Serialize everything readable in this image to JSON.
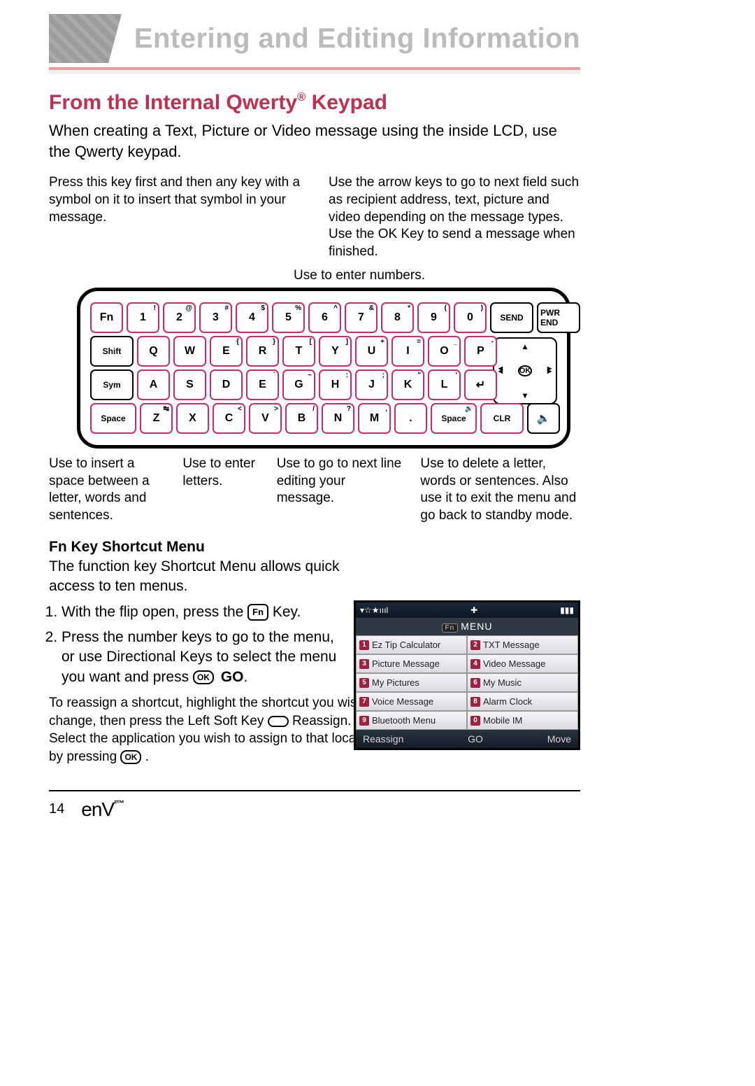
{
  "header": {
    "chapter_title": "Entering and Editing Information"
  },
  "section": {
    "title_prefix": "From the Internal Qwerty",
    "title_sup": "®",
    "title_suffix": " Keypad",
    "intro": "When creating a Text, Picture or Video message using the inside LCD, use the Qwerty keypad."
  },
  "callouts": {
    "top_left": "Press this key first and then any key with a symbol on it to insert that symbol in your message.",
    "top_right": "Use the arrow keys to go to next field such as recipient address, text, picture and video depending on the message types. Use the OK Key to send a message when finished.",
    "numbers": "Use to enter numbers.",
    "space": "Use to insert a space between a letter, words and sentences.",
    "letters": "Use to enter letters.",
    "enter": "Use to go to next line editing your message.",
    "clr": "Use to delete a letter, words or sentences. Also use it to exit the menu and go back to standby mode."
  },
  "keyboard": {
    "dpad_label": "OK",
    "rows": [
      [
        {
          "main": "Fn",
          "wide": false,
          "hl": true
        },
        {
          "main": "1",
          "sup": "!",
          "hl": true
        },
        {
          "main": "2",
          "sup": "@",
          "hl": true
        },
        {
          "main": "3",
          "sup": "#",
          "hl": true
        },
        {
          "main": "4",
          "sup": "$",
          "hl": true
        },
        {
          "main": "5",
          "sup": "%",
          "hl": true
        },
        {
          "main": "6",
          "sup": "^",
          "hl": true
        },
        {
          "main": "7",
          "sup": "&",
          "hl": true
        },
        {
          "main": "8",
          "sup": "*",
          "hl": true
        },
        {
          "main": "9",
          "sup": "(",
          "hl": true
        },
        {
          "main": "0",
          "sup": ")",
          "hl": true
        },
        {
          "main": "SEND",
          "wide": true
        },
        {
          "main": "PWR END",
          "wide": true
        }
      ],
      [
        {
          "main": "Shift",
          "wide": true
        },
        {
          "main": "Q",
          "hl": true
        },
        {
          "main": "W",
          "hl": true
        },
        {
          "main": "E",
          "sup": "{",
          "hl": true
        },
        {
          "main": "R",
          "sup": "}",
          "hl": true
        },
        {
          "main": "T",
          "sup": "[",
          "hl": true
        },
        {
          "main": "Y",
          "sup": "]",
          "hl": true
        },
        {
          "main": "U",
          "sup": "+",
          "hl": true
        },
        {
          "main": "I",
          "sup": "=",
          "hl": true
        },
        {
          "main": "O",
          "sup": "_",
          "hl": true
        },
        {
          "main": "P",
          "sup": "-",
          "hl": true
        }
      ],
      [
        {
          "main": "Sym",
          "wide": true
        },
        {
          "main": "A",
          "hl": true
        },
        {
          "main": "S",
          "hl": true
        },
        {
          "main": "D",
          "hl": true
        },
        {
          "main": "E",
          "sup": "`",
          "hl": true
        },
        {
          "main": "G",
          "sup": "~",
          "hl": true
        },
        {
          "main": "H",
          "sup": ":",
          "hl": true
        },
        {
          "main": "J",
          "sup": ";",
          "hl": true
        },
        {
          "main": "K",
          "sup": "\"",
          "hl": true
        },
        {
          "main": "L",
          "sup": "'",
          "hl": true
        },
        {
          "main": "↵",
          "hl": true
        }
      ],
      [
        {
          "main": "Space",
          "space": true,
          "hl": true
        },
        {
          "main": "Z",
          "sup": "↹",
          "hl": true
        },
        {
          "main": "X",
          "hl": true
        },
        {
          "main": "C",
          "sup": "<",
          "hl": true
        },
        {
          "main": "V",
          "sup": ">",
          "hl": true
        },
        {
          "main": "B",
          "sup": "/",
          "hl": true
        },
        {
          "main": "N",
          "sup": "?",
          "hl": true
        },
        {
          "main": "M",
          "sup": ",",
          "hl": true
        },
        {
          "main": ".",
          "hl": true
        },
        {
          "main": "Space",
          "space": true,
          "sup": "🔊",
          "hl": true
        },
        {
          "main": "CLR",
          "wide": true,
          "hl": true
        },
        {
          "main": "🔈",
          "wide": false
        }
      ]
    ]
  },
  "fn_menu": {
    "heading": "Fn Key Shortcut Menu",
    "intro": "The function key Shortcut Menu allows quick access to ten menus.",
    "step1_a": "With the flip open, press the ",
    "step1_key": "Fn",
    "step1_b": " Key.",
    "step2_a": "Press the number keys to go to the menu, or use Directional Keys to select the menu you want and press ",
    "step2_ok": "OK",
    "step2_go": "GO",
    "step2_b": ".",
    "reassign_a": "To reassign a shortcut, highlight the shortcut you wish to change, then press the Left Soft Key ",
    "reassign_label": " Reassign",
    "reassign_b": ". Select the application you wish to assign to that location by pressing ",
    "reassign_ok": "OK",
    "reassign_c": " ."
  },
  "phone": {
    "status_left": "▾☆★ıııl",
    "status_center": "✚",
    "status_batt": "▮▮▮",
    "title_fn": "Fn",
    "title": "MENU",
    "items": [
      {
        "n": "1",
        "label": "Ez Tip Calculator"
      },
      {
        "n": "2",
        "label": "TXT Message"
      },
      {
        "n": "3",
        "label": "Picture Message"
      },
      {
        "n": "4",
        "label": "Video Message"
      },
      {
        "n": "5",
        "label": "My Pictures"
      },
      {
        "n": "6",
        "label": "My Music"
      },
      {
        "n": "7",
        "label": "Voice Message"
      },
      {
        "n": "8",
        "label": "Alarm Clock"
      },
      {
        "n": "9",
        "label": "Bluetooth Menu"
      },
      {
        "n": "0",
        "label": "Mobile IM"
      }
    ],
    "soft_left": "Reassign",
    "soft_center": "GO",
    "soft_right": "Move"
  },
  "footer": {
    "page": "14",
    "logo": "enV",
    "logo_sup": "²™"
  }
}
